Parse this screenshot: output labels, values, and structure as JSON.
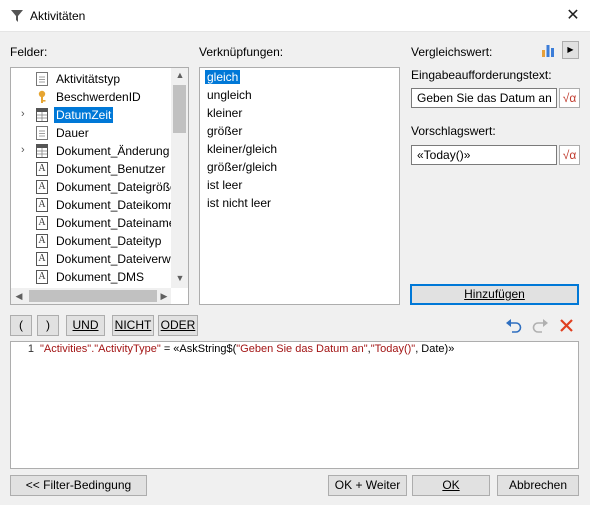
{
  "window": {
    "title": "Aktivitäten",
    "close_glyph": "✕"
  },
  "fields": {
    "label": "Felder:",
    "items": [
      {
        "label": "Aktivitätstyp",
        "icon": "document-icon",
        "expandable": false,
        "selected": false
      },
      {
        "label": "BeschwerdenID",
        "icon": "key-icon",
        "expandable": false,
        "selected": false
      },
      {
        "label": "DatumZeit",
        "icon": "calendar-icon",
        "expandable": true,
        "selected": true
      },
      {
        "label": "Dauer",
        "icon": "document-icon",
        "expandable": false,
        "selected": false
      },
      {
        "label": "Dokument_Änderung",
        "icon": "calendar-icon",
        "expandable": true,
        "selected": false
      },
      {
        "label": "Dokument_Benutzer",
        "icon": "text-field-icon",
        "expandable": false,
        "selected": false
      },
      {
        "label": "Dokument_Dateigröße",
        "icon": "text-field-icon",
        "expandable": false,
        "selected": false
      },
      {
        "label": "Dokument_Dateikomm",
        "icon": "text-field-icon",
        "expandable": false,
        "selected": false
      },
      {
        "label": "Dokument_Dateiname",
        "icon": "text-field-icon",
        "expandable": false,
        "selected": false
      },
      {
        "label": "Dokument_Dateityp",
        "icon": "text-field-icon",
        "expandable": false,
        "selected": false
      },
      {
        "label": "Dokument_Dateiverwe",
        "icon": "text-field-icon",
        "expandable": false,
        "selected": false
      },
      {
        "label": "Dokument_DMS",
        "icon": "text-field-icon",
        "expandable": false,
        "selected": false
      }
    ]
  },
  "links": {
    "label": "Verknüpfungen:",
    "items": [
      "gleich",
      "ungleich",
      "kleiner",
      "größer",
      "kleiner/gleich",
      "größer/gleich",
      "ist leer",
      "ist nicht leer"
    ],
    "selected_index": 0
  },
  "compare": {
    "label": "Vergleichswert:",
    "chart_icon": "bar-chart-icon",
    "arrow_glyph": "▶",
    "prompt_label": "Eingabeaufforderungstext:",
    "prompt_value": "Geben Sie das Datum an",
    "suggest_label": "Vorschlagswert:",
    "suggest_value": "«Today()»",
    "formula_glyph": "√α",
    "add_button": "Hinzufügen"
  },
  "operators": {
    "open_paren": "(",
    "close_paren": ")",
    "and": "UND",
    "not": "NICHT",
    "or": "ODER"
  },
  "editor": {
    "line_number": "1",
    "code_field": "\"Activities\".\"ActivityType\"",
    "code_op": " = «AskString$(",
    "code_arg1": "\"Geben Sie das Datum an\"",
    "code_comma": ",",
    "code_arg2": "\"Today()\"",
    "code_tail": ", Date)»"
  },
  "buttons": {
    "filter": "<< Filter-Bedingung",
    "ok_next": "OK + Weiter",
    "ok": "OK",
    "cancel": "Abbrechen"
  },
  "colors": {
    "selection": "#0078d7",
    "string_literal": "#a31515",
    "delete": "#e04020",
    "undo": "#2f6fc0"
  }
}
